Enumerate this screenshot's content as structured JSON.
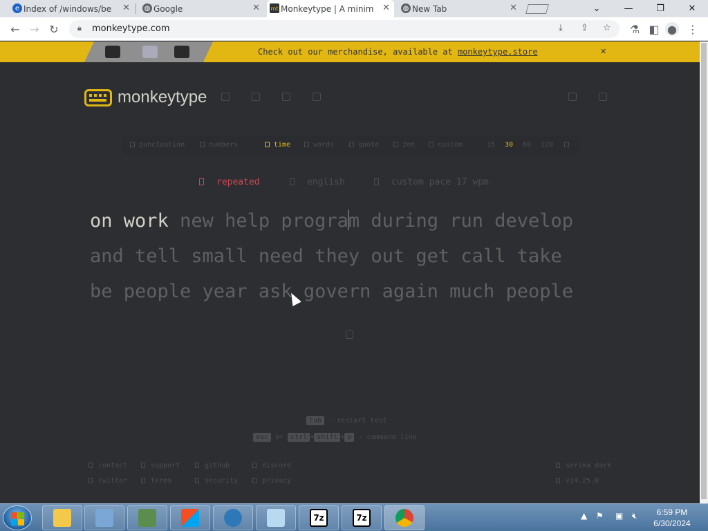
{
  "browser": {
    "tabs": [
      {
        "title": "Index of /windows/be",
        "icon": "ie-page-icon"
      },
      {
        "title": "Google",
        "icon": "globe-icon"
      },
      {
        "title": "Monkeytype | A minim",
        "icon": "monkeytype-icon",
        "active": true
      },
      {
        "title": "New Tab",
        "icon": "globe-icon"
      }
    ],
    "url": "monkeytype.com"
  },
  "banner": {
    "message": "Check out our merchandise, available at ",
    "link": "monkeytype.store"
  },
  "header": {
    "logo_text": "monkeytype"
  },
  "config": {
    "punctuation": "punctuation",
    "numbers": "numbers",
    "time": "time",
    "words": "words",
    "quote": "quote",
    "zen": "zen",
    "custom": "custom",
    "durations": [
      "15",
      "30",
      "60",
      "120"
    ],
    "selected_duration": "30"
  },
  "test_mode": {
    "repeated": "repeated",
    "language": "english",
    "pace": "custom pace 17 wpm"
  },
  "words": {
    "typed": "on work",
    "line1_a": "new help progra",
    "line1_b": "m during run develop",
    "line2": "and tell small need they out get call take",
    "line3": "be people year ask govern again much people"
  },
  "hints": {
    "tab_key": "tab",
    "restart": "- restart test",
    "esc_key": "esc",
    "or": "or",
    "ctrl_key": "ctrl",
    "shift_key": "shift",
    "p_key": "p",
    "plus": "+",
    "command_line": "- command line"
  },
  "footer": {
    "contact": "contact",
    "support": "support",
    "github": "github",
    "discord": "discord",
    "twitter": "twitter",
    "terms": "terms",
    "security": "security",
    "privacy": "privacy",
    "theme": "serika dark",
    "version": "v24.25.0"
  },
  "taskbar": {
    "time": "6:59 PM",
    "date": "6/30/2024",
    "app_7z_1": "7z",
    "app_7z_2": "7z"
  },
  "colors": {
    "accent": "#e2b714",
    "background": "#2c2e31",
    "text": "#d1d0c5",
    "sub": "#646669",
    "error": "#ca4754"
  }
}
